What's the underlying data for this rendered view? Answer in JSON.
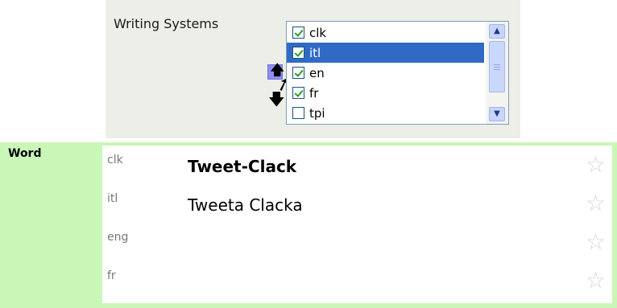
{
  "writing_systems": {
    "label": "Writing Systems",
    "items": [
      {
        "code": "clk",
        "checked": true,
        "selected": false
      },
      {
        "code": "itl",
        "checked": true,
        "selected": true
      },
      {
        "code": "en",
        "checked": true,
        "selected": false
      },
      {
        "code": "fr",
        "checked": true,
        "selected": false
      },
      {
        "code": "tpi",
        "checked": false,
        "selected": false
      }
    ]
  },
  "word_field": {
    "label": "Word",
    "lines": [
      {
        "ws": "clk",
        "value": "Tweet-Clack"
      },
      {
        "ws": "itl",
        "value": "Tweeta Clacka"
      },
      {
        "ws": "eng",
        "value": ""
      },
      {
        "ws": "fr",
        "value": ""
      }
    ]
  },
  "colors": {
    "selection": "#316ac5",
    "field_bg": "#c9f7b8",
    "panel_bg": "#eeeee8"
  },
  "icons": {
    "move_up": "arrow-up-icon",
    "move_down": "arrow-down-icon",
    "cursor": "mouse-pointer-icon",
    "star": "star-icon"
  }
}
